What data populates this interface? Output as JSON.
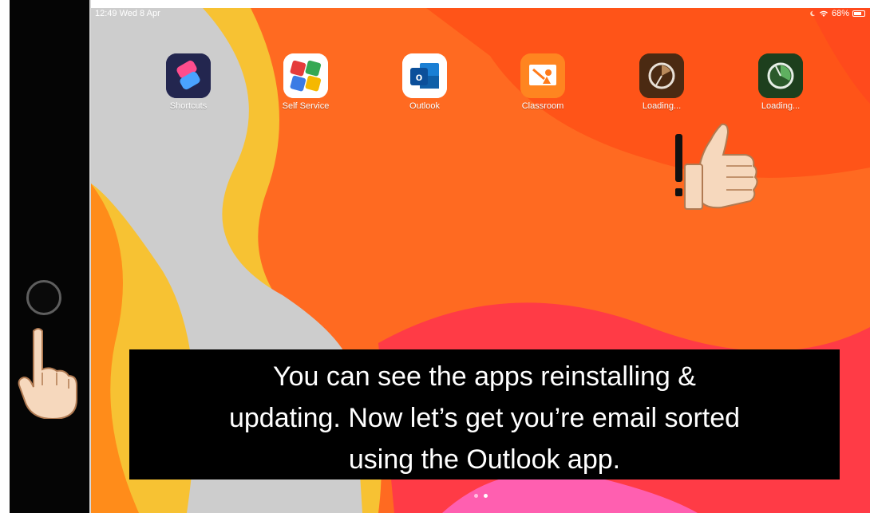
{
  "status_bar": {
    "time_date": "12:49 Wed 8 Apr",
    "battery_percent": "68%"
  },
  "apps": [
    {
      "label": "Shortcuts",
      "icon": "shortcuts-icon"
    },
    {
      "label": "Self Service",
      "icon": "self-service-icon"
    },
    {
      "label": "Outlook",
      "icon": "outlook-icon"
    },
    {
      "label": "Classroom",
      "icon": "classroom-icon"
    },
    {
      "label": "Loading...",
      "icon": "loading-app-icon"
    },
    {
      "label": "Loading...",
      "icon": "loading-app-icon"
    }
  ],
  "caption": {
    "line1": "You can see the apps reinstalling &",
    "line2": "updating. Now let’s get you’re email sorted",
    "line3": "using the Outlook app."
  },
  "page_indicator": {
    "pages": 2,
    "current": 2
  },
  "colors": {
    "wallpaper_orange": "#ff6a21",
    "wallpaper_grey": "#c9c9c9",
    "caption_bg": "#000000"
  }
}
